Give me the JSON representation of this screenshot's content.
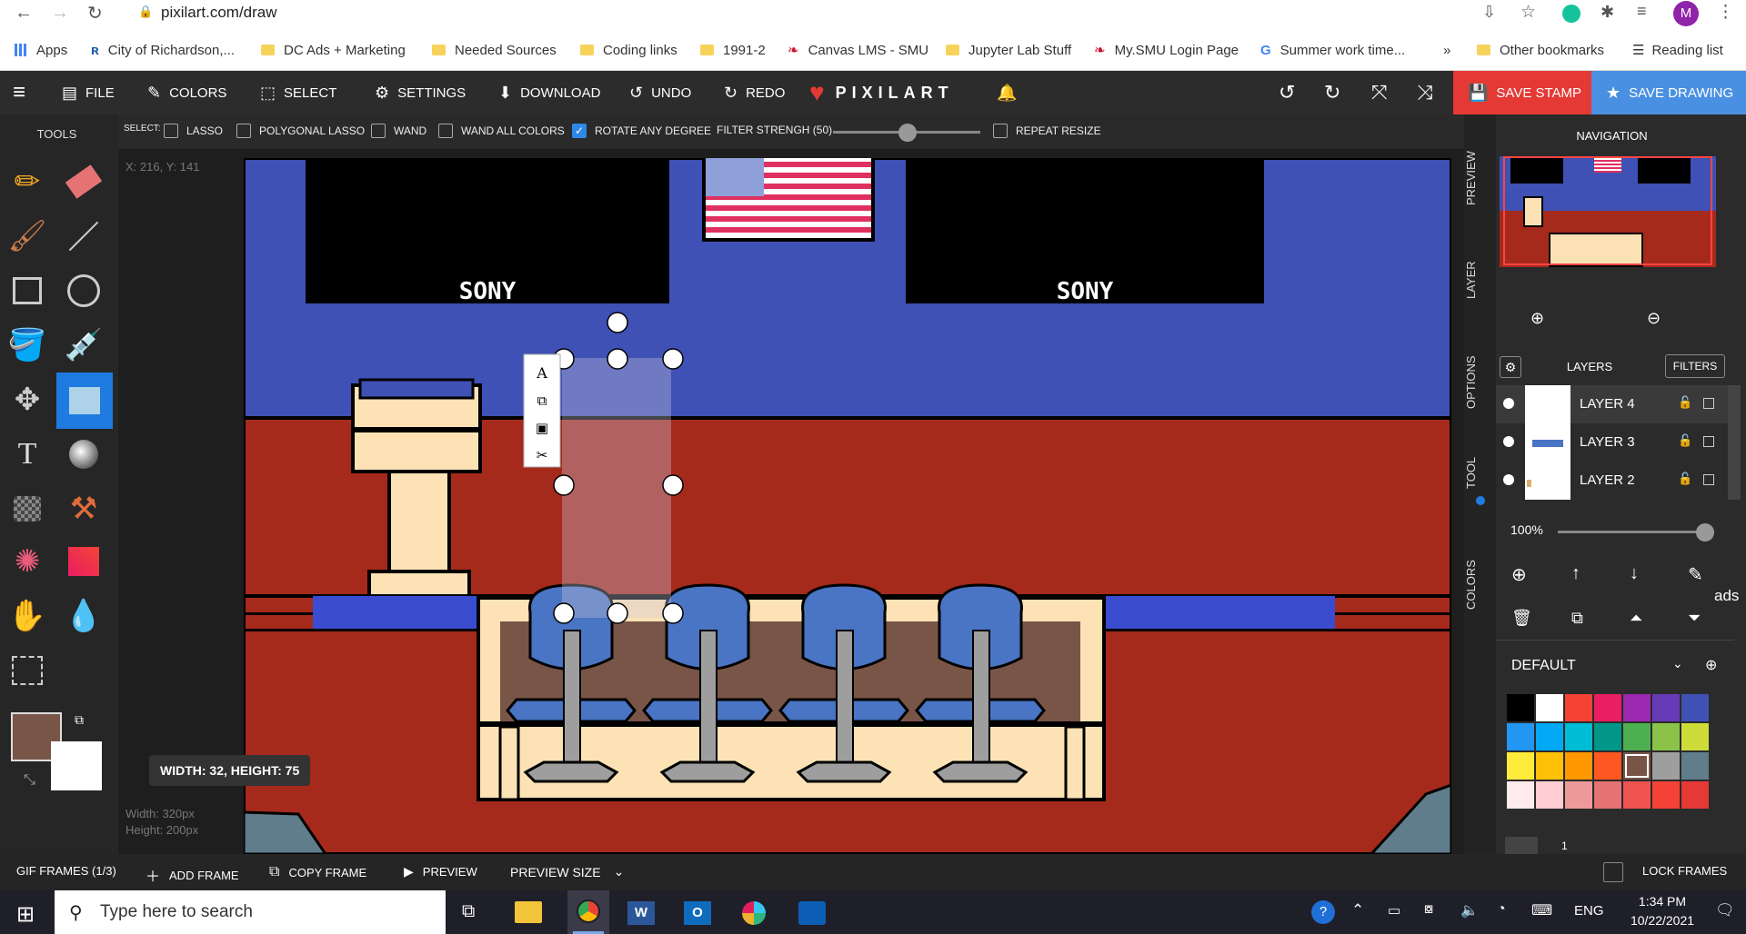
{
  "browser": {
    "url": "pixilart.com/draw",
    "profile_initial": "M"
  },
  "bookmarks": [
    {
      "label": "Apps"
    },
    {
      "label": "City of Richardson,..."
    },
    {
      "label": "DC Ads + Marketing"
    },
    {
      "label": "Needed Sources"
    },
    {
      "label": "Coding links"
    },
    {
      "label": "1991-2"
    },
    {
      "label": "Canvas LMS - SMU"
    },
    {
      "label": "Jupyter Lab Stuff"
    },
    {
      "label": "My.SMU Login Page"
    },
    {
      "label": "Summer work time..."
    },
    {
      "label": "»"
    },
    {
      "label": "Other bookmarks"
    },
    {
      "label": "Reading list"
    }
  ],
  "menu": {
    "file": "FILE",
    "colors": "COLORS",
    "select": "SELECT",
    "settings": "SETTINGS",
    "download": "DOWNLOAD",
    "undo": "UNDO",
    "redo": "REDO",
    "brand": "PIXILART",
    "save_stamp": "SAVE STAMP",
    "save_drawing": "SAVE DRAWING"
  },
  "select_options": {
    "label": "SELECT:",
    "lasso": "LASSO",
    "polygonal_lasso": "POLYGONAL LASSO",
    "wand": "WAND",
    "wand_all_colors": "WAND ALL COLORS",
    "rotate_any_degree": "ROTATE ANY DEGREE",
    "rotate_checked": true,
    "filter_strength": "FILTER STRENGH (50)",
    "filter_value": 50,
    "repeat_resize": "REPEAT RESIZE"
  },
  "tools_panel": {
    "title": "TOOLS",
    "primary_color": "#795548",
    "secondary_color": "#ffffff"
  },
  "canvas": {
    "cursor_pos": "X: 216, Y: 141",
    "selection_size": "WIDTH: 32, HEIGHT: 75",
    "dims_width": "Width: 320px",
    "dims_height": "Height: 200px",
    "monitor_left_text": "SONY",
    "monitor_right_text": "SONY"
  },
  "side_tabs": [
    "PREVIEW",
    "LAYER",
    "OPTIONS",
    "TOOL",
    "COLORS"
  ],
  "right_panel": {
    "navigation_title": "NAVIGATION",
    "layers_title": "LAYERS",
    "filters_label": "FILTERS",
    "layers": [
      {
        "name": "LAYER 4"
      },
      {
        "name": "LAYER 3"
      },
      {
        "name": "LAYER 2"
      }
    ],
    "opacity": "100%",
    "palette_name": "DEFAULT",
    "ads_label": "ads",
    "frame_number": "1",
    "palette_colors": [
      "#000000",
      "#ffffff",
      "#f44336",
      "#e91e63",
      "#9c27b0",
      "#673ab7",
      "#3f51b5",
      "#2196f3",
      "#03a9f4",
      "#00bcd4",
      "#009688",
      "#4caf50",
      "#8bc34a",
      "#cddc39",
      "#ffeb3b",
      "#ffc107",
      "#ff9800",
      "#ff5722",
      "#795548",
      "#9e9e9e",
      "#607d8b",
      "#ffebee",
      "#ffcdd2",
      "#ef9a9a",
      "#e57373",
      "#ef5350",
      "#f44336",
      "#e53935"
    ]
  },
  "bottom_bar": {
    "gif_frames": "GIF FRAMES (1/3)",
    "add_frame": "ADD FRAME",
    "copy_frame": "COPY FRAME",
    "preview": "PREVIEW",
    "preview_size": "PREVIEW SIZE",
    "lock_frames": "LOCK FRAMES"
  },
  "taskbar": {
    "search_placeholder": "Type here to search",
    "language": "ENG",
    "time": "1:34 PM",
    "date": "10/22/2021"
  }
}
